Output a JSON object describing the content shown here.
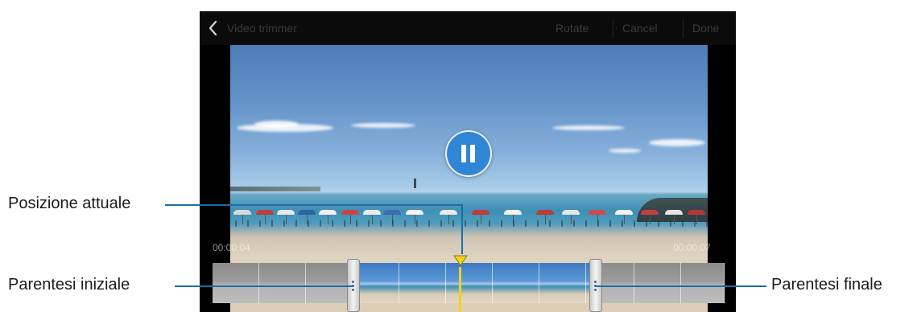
{
  "topbar": {
    "title": "Video trimmer",
    "buttons": {
      "rotate": "Rotate",
      "cancel": "Cancel",
      "done": "Done"
    }
  },
  "player": {
    "state": "playing",
    "time_start": "00:00:04",
    "time_end": "00:00:07"
  },
  "callouts": {
    "current_position": "Posizione attuale",
    "start_bracket": "Parentesi iniziale",
    "end_bracket": "Parentesi finale"
  },
  "colors": {
    "playhead": "#f2d21e",
    "pause_button": "#2f86d6",
    "leader_line": "#1a6ea8"
  },
  "icons": {
    "back": "chevron-left-icon",
    "pause": "pause-icon",
    "playhead": "triangle-down-icon"
  }
}
